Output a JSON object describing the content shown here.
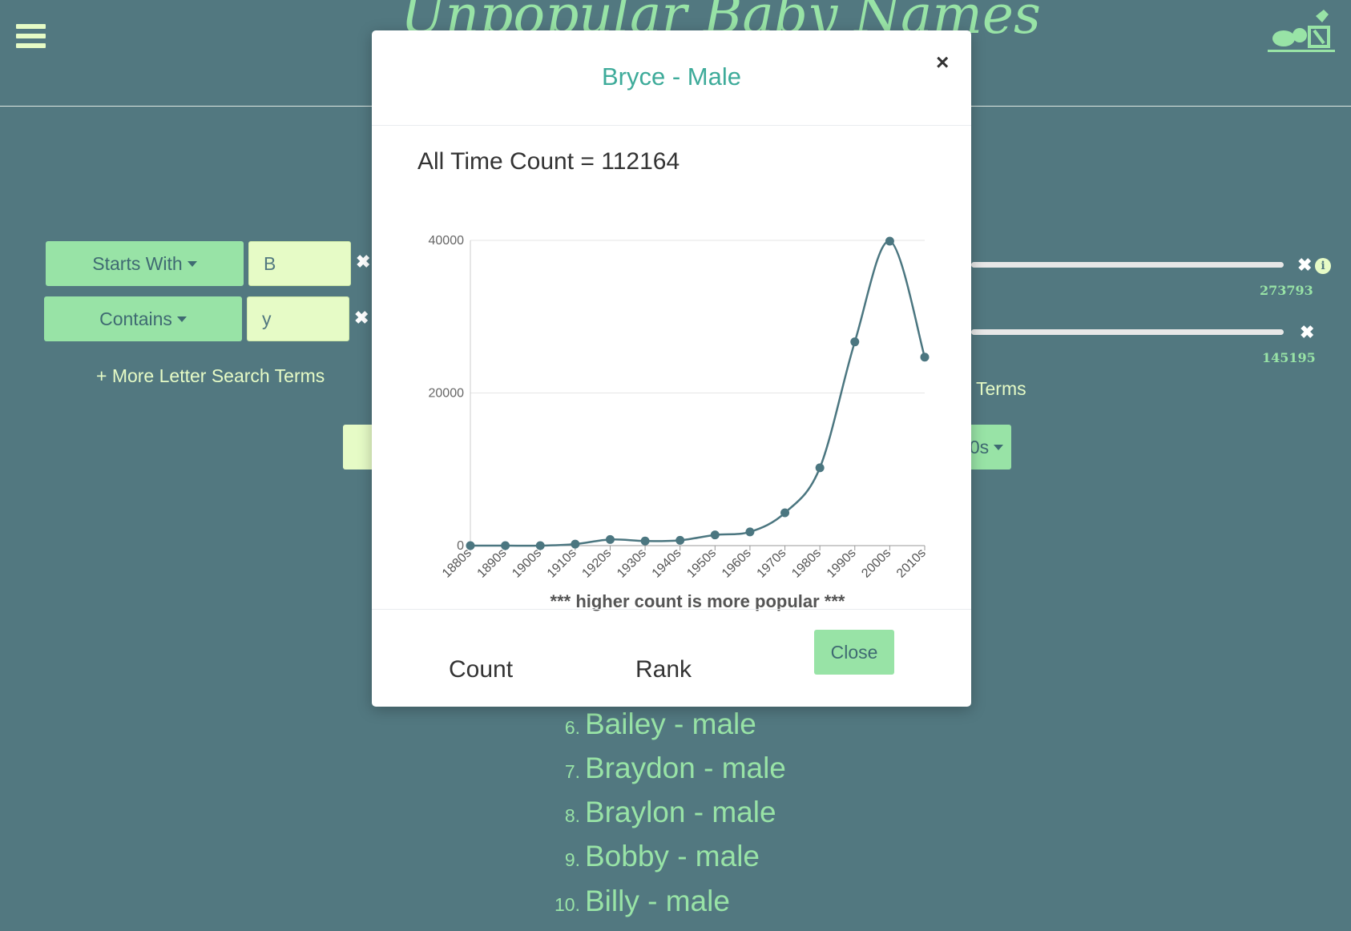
{
  "site": {
    "title": "Unpopular Baby Names"
  },
  "search": {
    "row1": {
      "select_label": "Starts With",
      "value": "B"
    },
    "row2": {
      "select_label": "Contains",
      "value": "y"
    },
    "remove_symbol": "✖",
    "more_link": "+ More Letter Search Terms"
  },
  "right_panel": {
    "slider1_value": "273793",
    "slider2_value": "145195",
    "info_symbol": "i",
    "terms_text": "Terms",
    "decade_label": "0s"
  },
  "modal": {
    "title": "Bryce - Male",
    "close_symbol": "×",
    "all_time_label": "All Time Count = 112164",
    "footer": {
      "count_label": "Count",
      "rank_label": "Rank",
      "close_label": "Close"
    }
  },
  "chart_data": {
    "type": "line",
    "categories": [
      "1880s",
      "1890s",
      "1900s",
      "1910s",
      "1920s",
      "1930s",
      "1940s",
      "1950s",
      "1960s",
      "1970s",
      "1980s",
      "1990s",
      "2000s",
      "2010s"
    ],
    "values": [
      0,
      0,
      0,
      200,
      800,
      600,
      700,
      1400,
      1800,
      4300,
      10200,
      26700,
      39900,
      24700
    ],
    "ylim": [
      0,
      40000
    ],
    "yticks": [
      "0",
      "20000",
      "40000"
    ],
    "ytick_values": [
      0,
      20000,
      40000
    ],
    "xlabel": "*** higher count is more popular ***",
    "ylabel": "",
    "grid": true,
    "line_color": "#4b7680"
  },
  "results": [
    {
      "num": "6.",
      "name": "Bailey - male"
    },
    {
      "num": "7.",
      "name": "Braydon - male"
    },
    {
      "num": "8.",
      "name": "Braylon - male"
    },
    {
      "num": "9.",
      "name": "Bobby - male"
    },
    {
      "num": "10.",
      "name": "Billy - male"
    }
  ]
}
